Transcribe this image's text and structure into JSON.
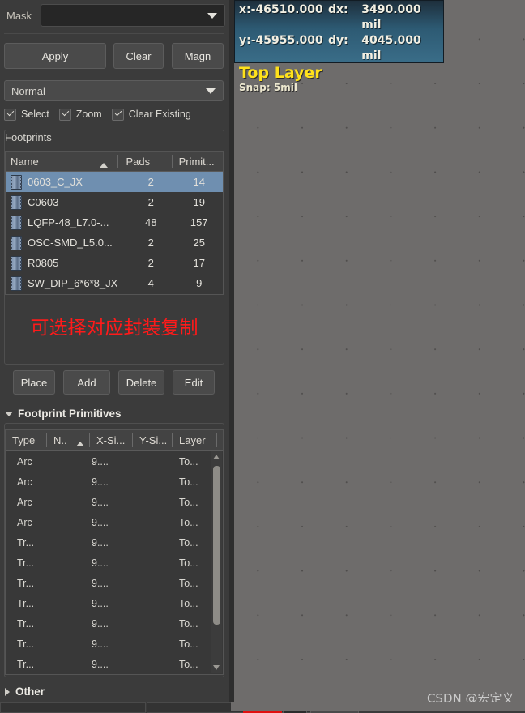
{
  "panel": {
    "mask": {
      "label": "Mask",
      "value": "",
      "placeholder": ""
    },
    "buttons": {
      "apply": "Apply",
      "clear": "Clear",
      "magnify": "Magn"
    },
    "mode_combo": {
      "value": "Normal"
    },
    "checkboxes": [
      {
        "label": "Select",
        "checked": true
      },
      {
        "label": "Zoom",
        "checked": true
      },
      {
        "label": "Clear Existing",
        "checked": true
      }
    ],
    "footprints": {
      "group_title": "Footprints",
      "columns": [
        "Name",
        "Pads",
        "Primit..."
      ],
      "sort_column": "Name",
      "sort_direction": "ascending",
      "rows": [
        {
          "name": "0603_C_JX",
          "pads": "2",
          "primitives": "14",
          "selected": true
        },
        {
          "name": "C0603",
          "pads": "2",
          "primitives": "19",
          "selected": false
        },
        {
          "name": "LQFP-48_L7.0-...",
          "pads": "48",
          "primitives": "157",
          "selected": false
        },
        {
          "name": "OSC-SMD_L5.0...",
          "pads": "2",
          "primitives": "25",
          "selected": false
        },
        {
          "name": "R0805",
          "pads": "2",
          "primitives": "17",
          "selected": false
        },
        {
          "name": "SW_DIP_6*6*8_JX",
          "pads": "4",
          "primitives": "9",
          "selected": false
        }
      ],
      "annotation": "可选择对应封装复制",
      "annotation_color": "#ff1a1a"
    },
    "footprint_actions": {
      "place": "Place",
      "add": "Add",
      "delete": "Delete",
      "edit": "Edit"
    },
    "primitives": {
      "section_title": "Footprint Primitives",
      "expanded": true,
      "columns": [
        "Type",
        "N..",
        "X-Si...",
        "Y-Si...",
        "Layer"
      ],
      "sort_column": "N..",
      "sort_direction": "ascending",
      "rows": [
        {
          "type": "Arc",
          "n": "",
          "x": "9....",
          "y": "",
          "layer": "To..."
        },
        {
          "type": "Arc",
          "n": "",
          "x": "9....",
          "y": "",
          "layer": "To..."
        },
        {
          "type": "Arc",
          "n": "",
          "x": "9....",
          "y": "",
          "layer": "To..."
        },
        {
          "type": "Arc",
          "n": "",
          "x": "9....",
          "y": "",
          "layer": "To..."
        },
        {
          "type": "Tr...",
          "n": "",
          "x": "9....",
          "y": "",
          "layer": "To..."
        },
        {
          "type": "Tr...",
          "n": "",
          "x": "9....",
          "y": "",
          "layer": "To..."
        },
        {
          "type": "Tr...",
          "n": "",
          "x": "9....",
          "y": "",
          "layer": "To..."
        },
        {
          "type": "Tr...",
          "n": "",
          "x": "9....",
          "y": "",
          "layer": "To..."
        },
        {
          "type": "Tr...",
          "n": "",
          "x": "9....",
          "y": "",
          "layer": "To..."
        },
        {
          "type": "Tr...",
          "n": "",
          "x": "9....",
          "y": "",
          "layer": "To..."
        },
        {
          "type": "Tr...",
          "n": "",
          "x": "9....",
          "y": "",
          "layer": "To..."
        }
      ]
    },
    "other": {
      "section_title": "Other",
      "expanded": false
    }
  },
  "canvas": {
    "info_box": {
      "x_label": "x:-46510.000",
      "dx_label": "dx:",
      "dx_value": "3490.000 mil",
      "y_label": "y:-45955.000",
      "dy_label": "dy:",
      "dy_value": "4045.000 mil",
      "layer": "Top Layer",
      "layer_color": "#ffe11a",
      "snap": "Snap: 5mil"
    },
    "watermark": "CSDN @宏定义_"
  },
  "icons": {
    "combo_arrow": "chevron-down-icon",
    "sort_arrow": "sort-ascending-icon",
    "footprint": "ic-chip-icon",
    "expand": "triangle-down-icon",
    "collapse": "triangle-right-icon"
  },
  "colors": {
    "panel_bg": "#3b3b3b",
    "canvas_bg": "#6e6c6b",
    "selection": "#6f8fb0",
    "info_box": "#2d5a73",
    "accent_red": "#ff1a1a",
    "layer_yellow": "#ffe11a"
  }
}
